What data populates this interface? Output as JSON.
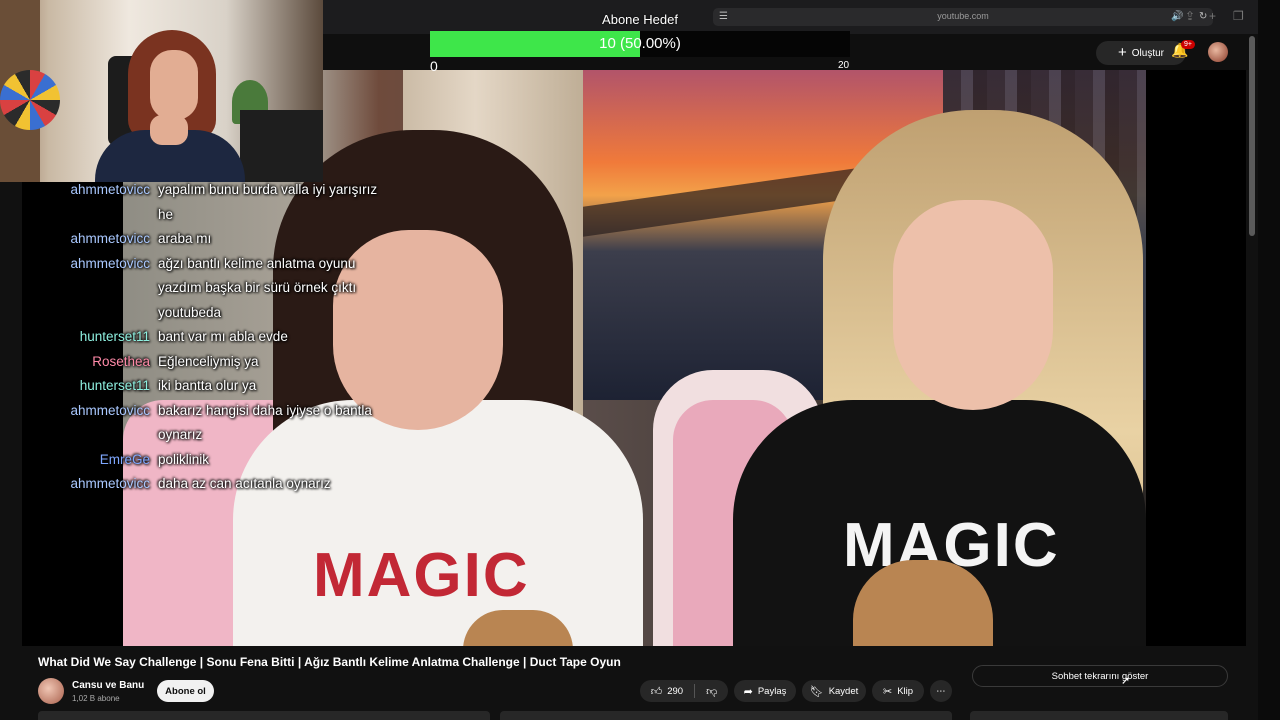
{
  "browser": {
    "url": "youtube.com"
  },
  "header": {
    "create_label": "Oluştur",
    "notification_count": "9+"
  },
  "goal_overlay": {
    "title": "Abone Hedef",
    "progress_text": "10 (50.00%)",
    "progress_fraction": 0.5,
    "min": "0",
    "max": "20",
    "fill_color": "#3ee64a"
  },
  "chat": {
    "messages": [
      {
        "user": "ahmmetovicc",
        "text": "yapalım bunu burda valla iyi yarışırız he",
        "color": "#a9c8ff"
      },
      {
        "user": "ahmmetovicc",
        "text": "araba mı",
        "color": "#a9c8ff"
      },
      {
        "user": "ahmmetovicc",
        "text": "ağzı bantlı kelime anlatma oyunu yazdım başka bir sürü örnek çıktı youtubeda",
        "color": "#a9c8ff"
      },
      {
        "user": "hunterset11",
        "text": "bant var mı abla evde",
        "color": "#8ef0e0"
      },
      {
        "user": "Rosethea",
        "text": "Eğlenceliymiş ya",
        "color": "#ff8aa8"
      },
      {
        "user": "hunterset11",
        "text": "iki bantta olur ya",
        "color": "#8ef0e0"
      },
      {
        "user": "ahmmetovicc",
        "text": "bakarız hangisi daha iyiyse o bantla oynarız",
        "color": "#a9c8ff"
      },
      {
        "user": "EmreGe",
        "text": "poliklinik",
        "color": "#7fa8ff"
      },
      {
        "user": "ahmmetovicc",
        "text": "daha az can acıtanla oynarız",
        "color": "#a9c8ff"
      }
    ]
  },
  "video": {
    "title": "What Did We Say Challenge | Sonu Fena Bitti | Ağız Bantlı Kelime Anlatma Challenge | Duct Tape Oyun",
    "shirt_text_left": "MAGIC",
    "shirt_text_right": "MAGIC"
  },
  "channel": {
    "name": "Cansu ve Banu",
    "subscribers": "1,02 B abone",
    "subscribe_label": "Abone ol"
  },
  "actions": {
    "like_count": "290",
    "share_label": "Paylaş",
    "save_label": "Kaydet",
    "clip_label": "Klip",
    "more_label": "⋯"
  },
  "chat_replay": {
    "button_label": "Sohbet tekrarını göster"
  },
  "icons": {
    "like": "thumbs-up-icon",
    "dislike": "thumbs-down-icon",
    "share": "share-icon",
    "save": "bookmark-icon",
    "clip": "scissors-icon",
    "bell": "bell-icon",
    "create": "plus-icon"
  }
}
